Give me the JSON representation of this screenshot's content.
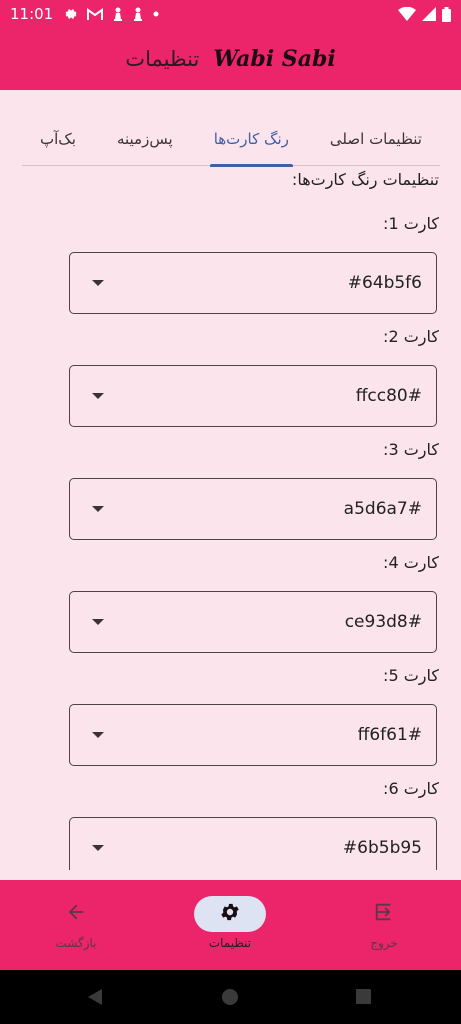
{
  "status_bar": {
    "time": "11:01",
    "icons_left": [
      "gear-icon",
      "gmail-icon",
      "chess-piece-icon",
      "chess-piece-icon",
      "dot-icon"
    ],
    "icons_right": [
      "wifi-icon",
      "signal-icon",
      "battery-icon"
    ]
  },
  "app_bar": {
    "title": "تنظیمات",
    "logo_text": "Wabi Sabi"
  },
  "tabs": [
    {
      "label": "تنظیمات اصلی",
      "active": false
    },
    {
      "label": "رنگ کارت‌ها",
      "active": true
    },
    {
      "label": "پس‌زمینه",
      "active": false
    },
    {
      "label": "بک‌آپ",
      "active": false
    }
  ],
  "section": {
    "title": "تنظیمات رنگ کارت‌ها:"
  },
  "cards": [
    {
      "label": "کارت 1:",
      "value": "#64b5f6"
    },
    {
      "label": "کارت 2:",
      "value": "ffcc80#"
    },
    {
      "label": "کارت 3:",
      "value": "a5d6a7#"
    },
    {
      "label": "کارت 4:",
      "value": "ce93d8#"
    },
    {
      "label": "کارت 5:",
      "value": "ff6f61#"
    },
    {
      "label": "کارت 6:",
      "value": "#6b5b95"
    }
  ],
  "bottom_nav": {
    "back_label": "بازگشت",
    "settings_label": "تنظیمات",
    "exit_label": "خروج"
  },
  "colors": {
    "primary": "#ec2469",
    "background": "#fbe4ec",
    "tab_active": "#3f5fa8",
    "nav_pill": "#dde3f2"
  }
}
